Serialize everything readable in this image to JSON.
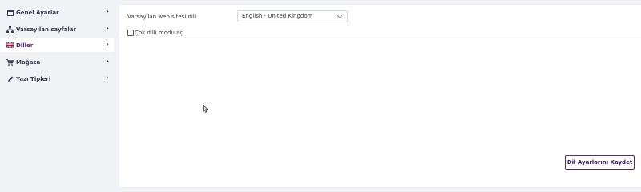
{
  "sidebar": {
    "items": [
      {
        "label": "Genel Ayarlar",
        "icon": "calendar-icon",
        "active": false
      },
      {
        "label": "Varsayılan sayfalar",
        "icon": "sitemap-icon",
        "active": false
      },
      {
        "label": "Diller",
        "icon": "flag-icon",
        "active": true
      },
      {
        "label": "Mağaza",
        "icon": "cart-icon",
        "active": false
      },
      {
        "label": "Yazı Tipleri",
        "icon": "pen-icon",
        "active": false
      }
    ],
    "chevron": "›"
  },
  "settings": {
    "default_language_label": "Varsayılan web sitesi dili",
    "default_language_value": "English - United Kingdom",
    "multilang_label": "Çok dilli modu aç",
    "multilang_checked": false
  },
  "actions": {
    "save_label": "Dil Ayarlarını Kaydet"
  },
  "colors": {
    "accent": "#5a2a78",
    "sidebar_bg": "#f1f2f6",
    "text": "#3a3f51"
  }
}
